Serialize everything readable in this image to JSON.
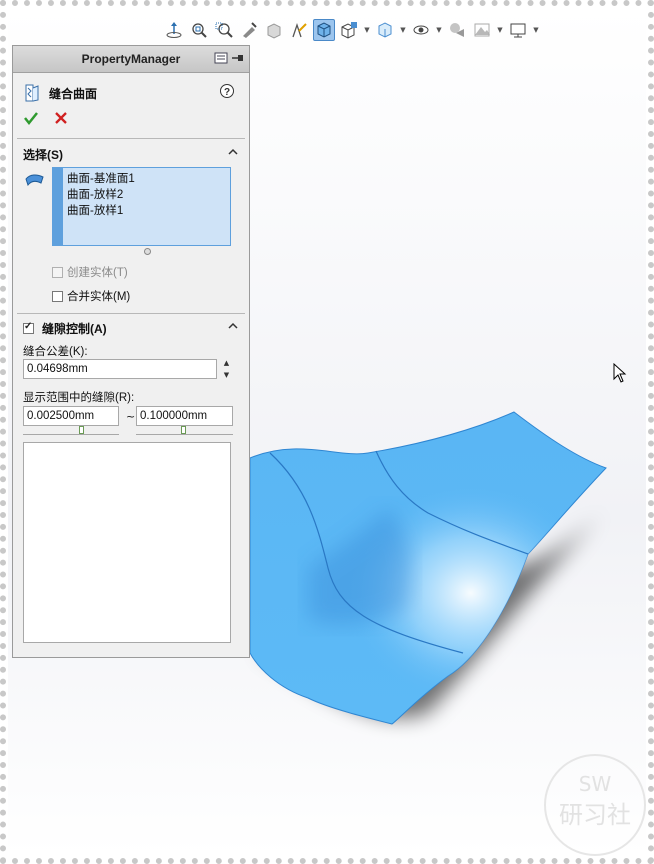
{
  "panel": {
    "title": "PropertyManager",
    "feature_name": "缝合曲面",
    "ok_label": "✓",
    "cancel_label": "✕"
  },
  "selection_group": {
    "title": "选择(S)",
    "items": [
      "曲面-基准面1",
      "曲面-放样2",
      "曲面-放样1"
    ],
    "create_solid_label": "创建实体(T)",
    "create_solid_checked": false,
    "create_solid_enabled": false,
    "merge_entities_label": "合并实体(M)",
    "merge_entities_checked": false
  },
  "gap_group": {
    "title": "缝隙控制(A)",
    "enabled": true,
    "tolerance_label": "缝合公差(K):",
    "tolerance_value": "0.04698mm",
    "range_label": "显示范围中的缝隙(R):",
    "range_min": "0.002500mm",
    "range_separator": "~",
    "range_max": "0.100000mm"
  },
  "toolbar": {
    "icons": [
      "view-orientation-icon",
      "zoom-to-fit-icon",
      "zoom-to-area-icon",
      "previous-view-icon",
      "section-view-icon",
      "dynamic-annotation-icon",
      "view-cube-icon",
      "display-style-icon",
      "hide-show-items-icon",
      "edit-appearance-icon",
      "apply-scene-icon",
      "view-settings-icon"
    ]
  },
  "colors": {
    "surface": "#5cb8f5",
    "selection": "#cfe3f7",
    "accent": "#5ea0dd",
    "ok": "#2f9a2f",
    "cancel": "#d02020"
  },
  "watermark": {
    "line1": "SW",
    "line2": "研习社"
  }
}
